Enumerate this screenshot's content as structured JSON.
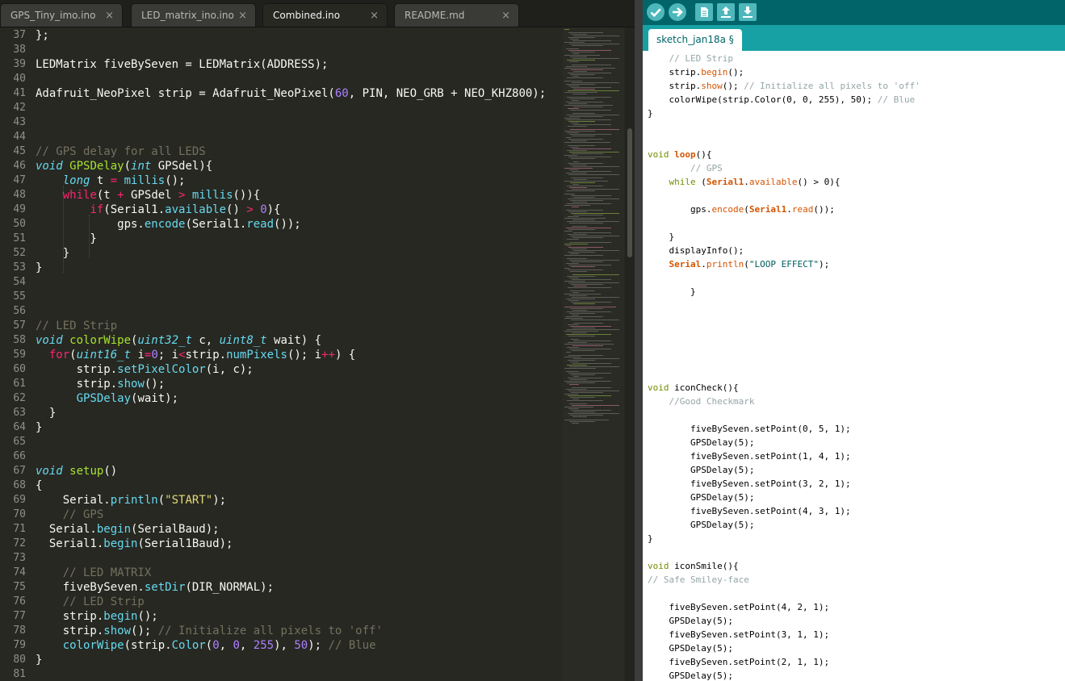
{
  "editor": {
    "tabs": [
      {
        "label": "GPS_Tiny_imo.ino",
        "close": "×"
      },
      {
        "label": "LED_matrix_ino.ino",
        "close": "×"
      },
      {
        "label": "Combined.ino",
        "close": "×"
      },
      {
        "label": "README.md",
        "close": "×"
      }
    ],
    "active_tab": 2,
    "lines": [
      {
        "n": "37",
        "t": [
          [
            "pl",
            "};"
          ]
        ]
      },
      {
        "n": "38",
        "t": []
      },
      {
        "n": "39",
        "t": [
          [
            "pl",
            "LEDMatrix fiveBySeven = LEDMatrix(ADDRESS);"
          ]
        ]
      },
      {
        "n": "40",
        "t": []
      },
      {
        "n": "41",
        "t": [
          [
            "pl",
            "Adafruit_NeoPixel strip = Adafruit_NeoPixel("
          ],
          [
            "nm",
            "60"
          ],
          [
            "pl",
            ", PIN, NEO_GRB + NEO_KHZ800);"
          ]
        ]
      },
      {
        "n": "42",
        "t": []
      },
      {
        "n": "43",
        "t": []
      },
      {
        "n": "44",
        "t": []
      },
      {
        "n": "45",
        "t": [
          [
            "cm",
            "// GPS delay for all LEDS"
          ]
        ]
      },
      {
        "n": "46",
        "t": [
          [
            "ty",
            "void"
          ],
          [
            "pl",
            " "
          ],
          [
            "fn",
            "GPSDelay"
          ],
          [
            "pl",
            "("
          ],
          [
            "ty",
            "int"
          ],
          [
            "pl",
            " GPSdel){"
          ]
        ]
      },
      {
        "n": "47",
        "t": [
          [
            "pl",
            "    "
          ],
          [
            "ty",
            "long"
          ],
          [
            "pl",
            " t "
          ],
          [
            "kw",
            "="
          ],
          [
            "pl",
            " "
          ],
          [
            "mt",
            "millis"
          ],
          [
            "pl",
            "();"
          ]
        ]
      },
      {
        "n": "48",
        "t": [
          [
            "pl",
            "    "
          ],
          [
            "kw",
            "while"
          ],
          [
            "pl",
            "(t "
          ],
          [
            "kw",
            "+"
          ],
          [
            "pl",
            " GPSdel "
          ],
          [
            "kw",
            ">"
          ],
          [
            "pl",
            " "
          ],
          [
            "mt",
            "millis"
          ],
          [
            "pl",
            "()){"
          ]
        ]
      },
      {
        "n": "49",
        "t": [
          [
            "pl",
            "        "
          ],
          [
            "kw",
            "if"
          ],
          [
            "pl",
            "(Serial1."
          ],
          [
            "mt",
            "available"
          ],
          [
            "pl",
            "() "
          ],
          [
            "kw",
            ">"
          ],
          [
            "pl",
            " "
          ],
          [
            "nm",
            "0"
          ],
          [
            "pl",
            "){"
          ]
        ]
      },
      {
        "n": "50",
        "t": [
          [
            "pl",
            "            gps."
          ],
          [
            "mt",
            "encode"
          ],
          [
            "pl",
            "(Serial1."
          ],
          [
            "mt",
            "read"
          ],
          [
            "pl",
            "());"
          ]
        ]
      },
      {
        "n": "51",
        "t": [
          [
            "pl",
            "        }"
          ]
        ]
      },
      {
        "n": "52",
        "t": [
          [
            "pl",
            "    }"
          ]
        ]
      },
      {
        "n": "53",
        "t": [
          [
            "pl",
            "}"
          ]
        ]
      },
      {
        "n": "54",
        "t": []
      },
      {
        "n": "55",
        "t": []
      },
      {
        "n": "56",
        "t": []
      },
      {
        "n": "57",
        "t": [
          [
            "cm",
            "// LED Strip"
          ]
        ]
      },
      {
        "n": "58",
        "t": [
          [
            "ty",
            "void"
          ],
          [
            "pl",
            " "
          ],
          [
            "fn",
            "colorWipe"
          ],
          [
            "pl",
            "("
          ],
          [
            "ty",
            "uint32_t"
          ],
          [
            "pl",
            " c, "
          ],
          [
            "ty",
            "uint8_t"
          ],
          [
            "pl",
            " wait) {"
          ]
        ]
      },
      {
        "n": "59",
        "t": [
          [
            "pl",
            "  "
          ],
          [
            "kw",
            "for"
          ],
          [
            "pl",
            "("
          ],
          [
            "ty",
            "uint16_t"
          ],
          [
            "pl",
            " i"
          ],
          [
            "kw",
            "="
          ],
          [
            "nm",
            "0"
          ],
          [
            "pl",
            "; i"
          ],
          [
            "kw",
            "<"
          ],
          [
            "pl",
            "strip."
          ],
          [
            "mt",
            "numPixels"
          ],
          [
            "pl",
            "(); i"
          ],
          [
            "kw",
            "++"
          ],
          [
            "pl",
            ") {"
          ]
        ]
      },
      {
        "n": "60",
        "t": [
          [
            "pl",
            "      strip."
          ],
          [
            "mt",
            "setPixelColor"
          ],
          [
            "pl",
            "(i, c);"
          ]
        ]
      },
      {
        "n": "61",
        "t": [
          [
            "pl",
            "      strip."
          ],
          [
            "mt",
            "show"
          ],
          [
            "pl",
            "();"
          ]
        ]
      },
      {
        "n": "62",
        "t": [
          [
            "pl",
            "      "
          ],
          [
            "mt",
            "GPSDelay"
          ],
          [
            "pl",
            "(wait);"
          ]
        ]
      },
      {
        "n": "63",
        "t": [
          [
            "pl",
            "  }"
          ]
        ]
      },
      {
        "n": "64",
        "t": [
          [
            "pl",
            "}"
          ]
        ]
      },
      {
        "n": "65",
        "t": []
      },
      {
        "n": "66",
        "t": []
      },
      {
        "n": "67",
        "t": [
          [
            "ty",
            "void"
          ],
          [
            "pl",
            " "
          ],
          [
            "fn",
            "setup"
          ],
          [
            "pl",
            "()"
          ]
        ]
      },
      {
        "n": "68",
        "t": [
          [
            "pl",
            "{"
          ]
        ]
      },
      {
        "n": "69",
        "t": [
          [
            "pl",
            "    Serial."
          ],
          [
            "mt",
            "println"
          ],
          [
            "pl",
            "("
          ],
          [
            "st",
            "\"START\""
          ],
          [
            "pl",
            ");"
          ]
        ]
      },
      {
        "n": "70",
        "t": [
          [
            "pl",
            "    "
          ],
          [
            "cm",
            "// GPS"
          ]
        ]
      },
      {
        "n": "71",
        "t": [
          [
            "pl",
            "  Serial."
          ],
          [
            "mt",
            "begin"
          ],
          [
            "pl",
            "(SerialBaud);"
          ]
        ]
      },
      {
        "n": "72",
        "t": [
          [
            "pl",
            "  Serial1."
          ],
          [
            "mt",
            "begin"
          ],
          [
            "pl",
            "(Serial1Baud);"
          ]
        ]
      },
      {
        "n": "73",
        "t": []
      },
      {
        "n": "74",
        "t": [
          [
            "pl",
            "    "
          ],
          [
            "cm",
            "// LED MATRIX"
          ]
        ]
      },
      {
        "n": "75",
        "t": [
          [
            "pl",
            "    fiveBySeven."
          ],
          [
            "mt",
            "setDir"
          ],
          [
            "pl",
            "(DIR_NORMAL);"
          ]
        ]
      },
      {
        "n": "76",
        "t": [
          [
            "pl",
            "    "
          ],
          [
            "cm",
            "// LED Strip"
          ]
        ]
      },
      {
        "n": "77",
        "t": [
          [
            "pl",
            "    strip."
          ],
          [
            "mt",
            "begin"
          ],
          [
            "pl",
            "();"
          ]
        ]
      },
      {
        "n": "78",
        "t": [
          [
            "pl",
            "    strip."
          ],
          [
            "mt",
            "show"
          ],
          [
            "pl",
            "(); "
          ],
          [
            "cm",
            "// Initialize all pixels to 'off'"
          ]
        ]
      },
      {
        "n": "79",
        "t": [
          [
            "pl",
            "    "
          ],
          [
            "mt",
            "colorWipe"
          ],
          [
            "pl",
            "(strip."
          ],
          [
            "mt",
            "Color"
          ],
          [
            "pl",
            "("
          ],
          [
            "nm",
            "0"
          ],
          [
            "pl",
            ", "
          ],
          [
            "nm",
            "0"
          ],
          [
            "pl",
            ", "
          ],
          [
            "nm",
            "255"
          ],
          [
            "pl",
            "), "
          ],
          [
            "nm",
            "50"
          ],
          [
            "pl",
            "); "
          ],
          [
            "cm",
            "// Blue"
          ]
        ]
      },
      {
        "n": "80",
        "t": [
          [
            "pl",
            "}"
          ]
        ]
      },
      {
        "n": "81",
        "t": []
      }
    ]
  },
  "arduino": {
    "toolbar_icons": [
      "verify-icon",
      "upload-icon",
      "new-icon",
      "open-icon",
      "save-icon"
    ],
    "tab_label": "sketch_jan18a §",
    "lines": [
      {
        "t": [
          [
            "pl",
            "    "
          ],
          [
            "cm",
            "// LED Strip"
          ]
        ]
      },
      {
        "t": [
          [
            "pl",
            "    strip."
          ],
          [
            "fn",
            "begin"
          ],
          [
            "pl",
            "();"
          ]
        ]
      },
      {
        "t": [
          [
            "pl",
            "    strip."
          ],
          [
            "fn",
            "show"
          ],
          [
            "pl",
            "(); "
          ],
          [
            "cm",
            "// Initialize all pixels to 'off'"
          ]
        ]
      },
      {
        "t": [
          [
            "pl",
            "    colorWipe(strip.Color(0, 0, 255), 50); "
          ],
          [
            "cm",
            "// Blue"
          ]
        ]
      },
      {
        "t": [
          [
            "pl",
            "}"
          ]
        ]
      },
      {
        "t": []
      },
      {
        "t": []
      },
      {
        "t": [
          [
            "kw",
            "void"
          ],
          [
            "pl",
            " "
          ],
          [
            "bkw",
            "loop"
          ],
          [
            "pl",
            "(){"
          ]
        ]
      },
      {
        "t": [
          [
            "pl",
            "        "
          ],
          [
            "cm",
            "// GPS"
          ]
        ]
      },
      {
        "t": [
          [
            "pl",
            "    "
          ],
          [
            "kw",
            "while"
          ],
          [
            "pl",
            " ("
          ],
          [
            "bkw",
            "Serial1"
          ],
          [
            "pl",
            "."
          ],
          [
            "fn",
            "available"
          ],
          [
            "pl",
            "() > 0){"
          ]
        ]
      },
      {
        "t": []
      },
      {
        "t": [
          [
            "pl",
            "        gps."
          ],
          [
            "fn",
            "encode"
          ],
          [
            "pl",
            "("
          ],
          [
            "bkw",
            "Serial1"
          ],
          [
            "pl",
            "."
          ],
          [
            "fn",
            "read"
          ],
          [
            "pl",
            "());"
          ]
        ]
      },
      {
        "t": []
      },
      {
        "t": [
          [
            "pl",
            "    }"
          ]
        ]
      },
      {
        "t": [
          [
            "pl",
            "    displayInfo();"
          ]
        ]
      },
      {
        "t": [
          [
            "pl",
            "    "
          ],
          [
            "bkw",
            "Serial"
          ],
          [
            "pl",
            "."
          ],
          [
            "fn",
            "println"
          ],
          [
            "pl",
            "("
          ],
          [
            "st",
            "\"LOOP EFFECT\""
          ],
          [
            "pl",
            ");"
          ]
        ]
      },
      {
        "t": []
      },
      {
        "t": [
          [
            "pl",
            "        }"
          ]
        ]
      },
      {
        "t": []
      },
      {
        "t": []
      },
      {
        "t": []
      },
      {
        "t": []
      },
      {
        "t": []
      },
      {
        "t": []
      },
      {
        "t": [
          [
            "kw",
            "void"
          ],
          [
            "pl",
            " iconCheck(){"
          ]
        ]
      },
      {
        "t": [
          [
            "pl",
            "    "
          ],
          [
            "cm",
            "//Good Checkmark"
          ]
        ]
      },
      {
        "t": []
      },
      {
        "t": [
          [
            "pl",
            "        fiveBySeven.setPoint(0, 5, 1);"
          ]
        ]
      },
      {
        "t": [
          [
            "pl",
            "        GPSDelay(5);"
          ]
        ]
      },
      {
        "t": [
          [
            "pl",
            "        fiveBySeven.setPoint(1, 4, 1);"
          ]
        ]
      },
      {
        "t": [
          [
            "pl",
            "        GPSDelay(5);"
          ]
        ]
      },
      {
        "t": [
          [
            "pl",
            "        fiveBySeven.setPoint(3, 2, 1);"
          ]
        ]
      },
      {
        "t": [
          [
            "pl",
            "        GPSDelay(5);"
          ]
        ]
      },
      {
        "t": [
          [
            "pl",
            "        fiveBySeven.setPoint(4, 3, 1);"
          ]
        ]
      },
      {
        "t": [
          [
            "pl",
            "        GPSDelay(5);"
          ]
        ]
      },
      {
        "t": [
          [
            "pl",
            "}"
          ]
        ]
      },
      {
        "t": []
      },
      {
        "t": [
          [
            "kw",
            "void"
          ],
          [
            "pl",
            " iconSmile(){"
          ]
        ]
      },
      {
        "t": [
          [
            "cm",
            "// Safe Smiley-face"
          ]
        ]
      },
      {
        "t": []
      },
      {
        "t": [
          [
            "pl",
            "    fiveBySeven.setPoint(4, 2, 1);"
          ]
        ]
      },
      {
        "t": [
          [
            "pl",
            "    GPSDelay(5);"
          ]
        ]
      },
      {
        "t": [
          [
            "pl",
            "    fiveBySeven.setPoint(3, 1, 1);"
          ]
        ]
      },
      {
        "t": [
          [
            "pl",
            "    GPSDelay(5);"
          ]
        ]
      },
      {
        "t": [
          [
            "pl",
            "    fiveBySeven.setPoint(2, 1, 1);"
          ]
        ]
      },
      {
        "t": [
          [
            "pl",
            "    GPSDelay(5);"
          ]
        ]
      }
    ]
  }
}
